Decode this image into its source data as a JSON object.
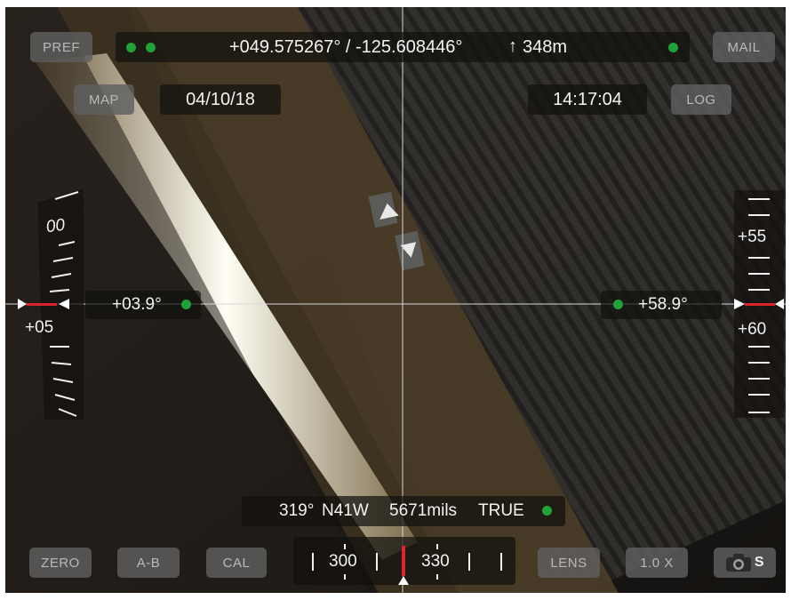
{
  "colors": {
    "status_dot": "#1fa339",
    "button_bg": "#5f5f5f",
    "marker_red": "#d9252b",
    "pill_bg": "#12100e"
  },
  "top": {
    "pref_label": "PREF",
    "mail_label": "MAIL",
    "coords": "+049.575267° / -125.608446°",
    "altitude_arrow": "↑",
    "altitude": "348m"
  },
  "second": {
    "map_label": "MAP",
    "date": "04/10/18",
    "time": "14:17:04",
    "log_label": "LOG"
  },
  "left_gauge": {
    "value": "+03.9°",
    "scale_top": "00",
    "scale_bottom": "+05"
  },
  "right_gauge": {
    "value": "+58.9°",
    "scale_top": "+55",
    "scale_bottom": "+60"
  },
  "heading": {
    "degrees": "319°",
    "cardinal": "N41W",
    "mils": "5671mils",
    "reference": "TRUE"
  },
  "compass": {
    "left_label": "300",
    "right_label": "330"
  },
  "bottom": {
    "zero_label": "ZERO",
    "ab_label": "A-B",
    "cal_label": "CAL",
    "lens_label": "LENS",
    "zoom_label": "1.0 X",
    "camera_suffix": "S"
  },
  "icons": {
    "camera": "camera-icon",
    "marker": "triangle-marker-icon"
  }
}
